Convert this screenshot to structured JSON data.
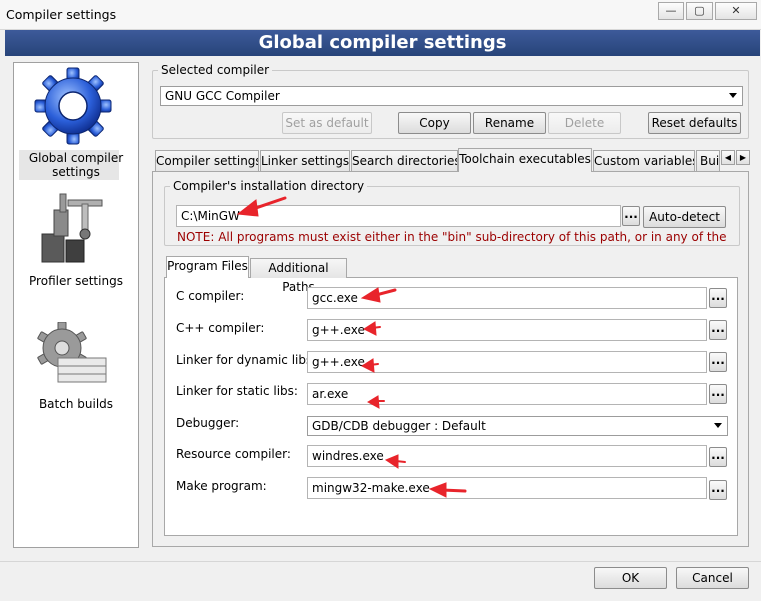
{
  "window": {
    "title": "Compiler settings",
    "minimize": "—",
    "maximize": "▢",
    "close": "✕"
  },
  "header": {
    "title": "Global compiler settings"
  },
  "sidebar": {
    "items": [
      {
        "label_line1": "Global compiler",
        "label_line2": "settings",
        "icon": "gear-icon"
      },
      {
        "label": "Profiler settings",
        "icon": "stopwatch-icon"
      },
      {
        "label": "Batch builds",
        "icon": "batch-gear-icon"
      }
    ]
  },
  "selected_compiler": {
    "group_title": "Selected compiler",
    "value": "GNU GCC Compiler",
    "buttons": {
      "set_default": "Set as default",
      "copy": "Copy",
      "rename": "Rename",
      "delete": "Delete",
      "reset": "Reset defaults"
    }
  },
  "tabs": [
    "Compiler settings",
    "Linker settings",
    "Search directories",
    "Toolchain executables",
    "Custom variables",
    "Buil"
  ],
  "tab_scroll": {
    "left": "◀",
    "right": "▶"
  },
  "install_dir": {
    "group_title": "Compiler's installation directory",
    "value": "C:\\MinGW",
    "browse": "...",
    "auto_detect": "Auto-detect",
    "note": "NOTE: All programs must exist either in the \"bin\" sub-directory of this path, or in any of the"
  },
  "subtabs": [
    "Program Files",
    "Additional Paths"
  ],
  "programs": [
    {
      "label": "C compiler:",
      "value": "gcc.exe"
    },
    {
      "label": "C++ compiler:",
      "value": "g++.exe"
    },
    {
      "label": "Linker for dynamic libs:",
      "value": "g++.exe"
    },
    {
      "label": "Linker for static libs:",
      "value": "ar.exe"
    },
    {
      "label": "Debugger:",
      "value": "GDB/CDB debugger : Default"
    },
    {
      "label": "Resource compiler:",
      "value": "windres.exe"
    },
    {
      "label": "Make program:",
      "value": "mingw32-make.exe"
    }
  ],
  "browse_label": "...",
  "footer": {
    "ok": "OK",
    "cancel": "Cancel"
  },
  "colors": {
    "header_bg": "#2f4d87",
    "annotation_arrow": "#e8242b",
    "note_text": "#9b0000"
  }
}
